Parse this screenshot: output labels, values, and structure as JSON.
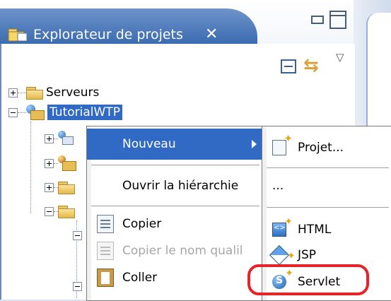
{
  "view": {
    "title": "Explorateur de projets",
    "close_glyph": "✕"
  },
  "tree": {
    "items": [
      {
        "label": "Serveurs",
        "expanded": false
      },
      {
        "label": "TutorialWTP",
        "expanded": true,
        "selected": true
      }
    ]
  },
  "context_menu": {
    "items": [
      {
        "label": "Nouveau",
        "highlighted": true,
        "has_submenu": true
      },
      {
        "label": "Ouvrir la hiérarchie"
      },
      {
        "label": "Copier",
        "icon": "copy-icon"
      },
      {
        "label": "Copier le nom qualil",
        "disabled": true,
        "icon": "copy-qualified-name-icon"
      },
      {
        "label": "Coller",
        "icon": "paste-icon"
      }
    ]
  },
  "submenu": {
    "items": [
      {
        "label": "Projet...",
        "icon": "new-project-icon"
      },
      {
        "label": "..."
      },
      {
        "label": "HTML",
        "icon": "new-html-icon"
      },
      {
        "label": "JSP",
        "icon": "new-jsp-icon"
      },
      {
        "label": "Servlet",
        "icon": "new-servlet-icon",
        "annotated": true
      }
    ]
  },
  "colors": {
    "selection": "#316ac5",
    "tab": "#3a6ab0",
    "annotation": "#e5232a"
  }
}
